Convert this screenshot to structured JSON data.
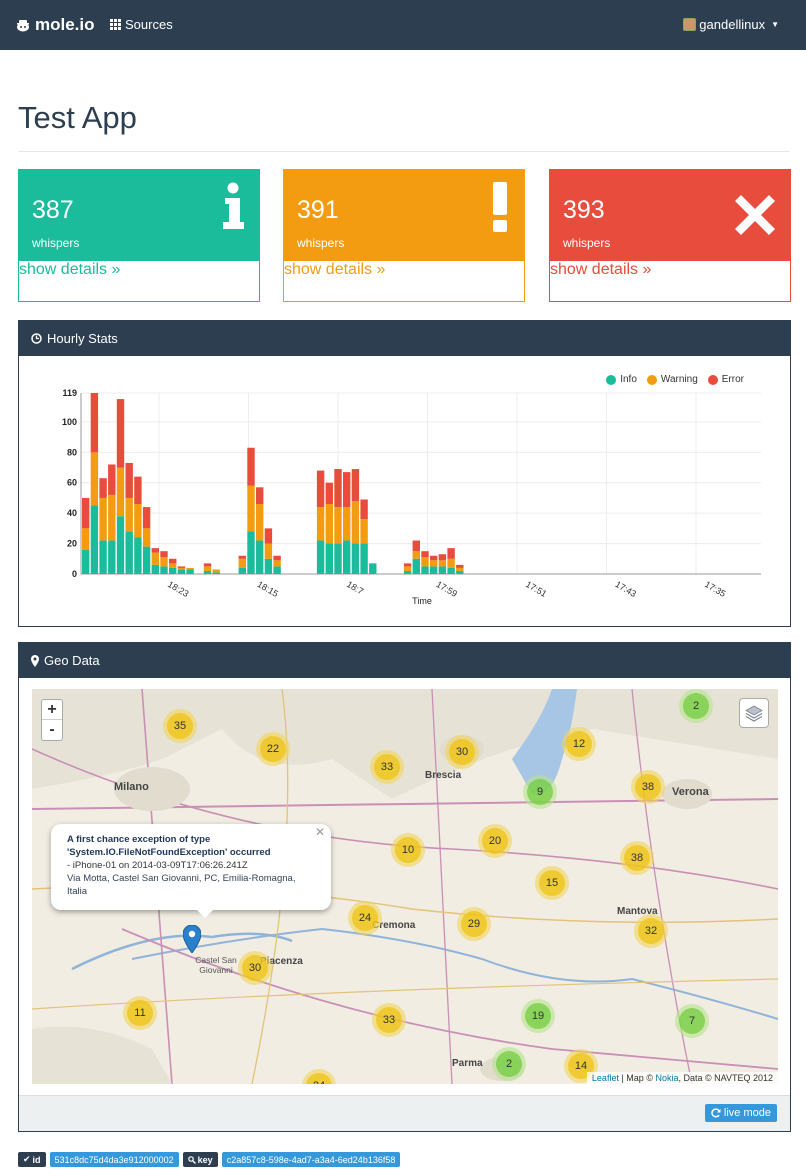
{
  "navbar": {
    "brand": "mole.io",
    "sources": "Sources",
    "user": "gandellinux"
  },
  "page": {
    "title": "Test App"
  },
  "cards": [
    {
      "value": "387",
      "label": "whispers",
      "link": "show details »",
      "color": "#1abc9c",
      "icon": "info-icon"
    },
    {
      "value": "391",
      "label": "whispers",
      "link": "show details »",
      "color": "#f39c12",
      "icon": "exclamation-icon"
    },
    {
      "value": "393",
      "label": "whispers",
      "link": "show details »",
      "color": "#e74c3c",
      "icon": "times-icon"
    }
  ],
  "hourly": {
    "title": "Hourly Stats",
    "chart_data": {
      "type": "bar",
      "stacked": true,
      "xlabel": "Time",
      "ylim": [
        0,
        119
      ],
      "yticks": [
        0,
        20,
        40,
        60,
        80,
        100,
        119
      ],
      "xticks": [
        "18:23",
        "18:15",
        "18:7",
        "17:59",
        "17:51",
        "17:43",
        "17:35"
      ],
      "legend_position": "top-right",
      "series": [
        {
          "name": "Info",
          "color": "#1abc9c",
          "values": [
            16,
            45,
            22,
            22,
            38,
            28,
            24,
            18,
            6,
            5,
            4,
            3,
            3,
            0,
            2,
            1,
            0,
            0,
            4,
            28,
            22,
            10,
            5,
            0,
            0,
            0,
            0,
            22,
            20,
            20,
            22,
            20,
            20,
            7,
            0,
            0,
            0,
            2,
            10,
            5,
            5,
            5,
            4,
            2
          ]
        },
        {
          "name": "Warning",
          "color": "#f39c12",
          "values": [
            14,
            35,
            28,
            30,
            32,
            22,
            22,
            12,
            8,
            6,
            3,
            1,
            1,
            0,
            3,
            2,
            0,
            0,
            6,
            30,
            24,
            10,
            4,
            0,
            0,
            0,
            0,
            22,
            26,
            24,
            22,
            28,
            16,
            0,
            0,
            0,
            0,
            3,
            5,
            6,
            4,
            4,
            6,
            2
          ]
        },
        {
          "name": "Error",
          "color": "#e74c3c",
          "values": [
            20,
            39,
            13,
            20,
            45,
            23,
            18,
            14,
            3,
            4,
            3,
            1,
            0,
            0,
            2,
            0,
            0,
            0,
            2,
            25,
            11,
            10,
            3,
            0,
            0,
            0,
            0,
            24,
            14,
            25,
            23,
            21,
            13,
            0,
            0,
            0,
            0,
            2,
            7,
            4,
            3,
            4,
            7,
            2
          ]
        }
      ]
    }
  },
  "geo": {
    "title": "Geo Data",
    "zoom_in": "+",
    "zoom_out": "-",
    "popup": {
      "title": "A first chance exception of type 'System.IO.FileNotFoundException' occurred",
      "line2": "- iPhone-01 on 2014-03-09T17:06:26.241Z",
      "line3": "Via Motta, Castel San Giovanni, PC, Emilia-Romagna, Italia"
    },
    "clusters": [
      {
        "n": "35",
        "c": "y"
      },
      {
        "n": "22",
        "c": "y"
      },
      {
        "n": "33",
        "c": "y"
      },
      {
        "n": "30",
        "c": "y"
      },
      {
        "n": "12",
        "c": "y"
      },
      {
        "n": "2",
        "c": "g"
      },
      {
        "n": "38",
        "c": "y"
      },
      {
        "n": "9",
        "c": "g"
      },
      {
        "n": "10",
        "c": "y"
      },
      {
        "n": "20",
        "c": "y"
      },
      {
        "n": "15",
        "c": "y"
      },
      {
        "n": "38",
        "c": "y"
      },
      {
        "n": "24",
        "c": "y"
      },
      {
        "n": "29",
        "c": "y"
      },
      {
        "n": "32",
        "c": "y"
      },
      {
        "n": "30",
        "c": "y"
      },
      {
        "n": "11",
        "c": "y"
      },
      {
        "n": "33",
        "c": "y"
      },
      {
        "n": "19",
        "c": "g"
      },
      {
        "n": "7",
        "c": "g"
      },
      {
        "n": "2",
        "c": "g"
      },
      {
        "n": "14",
        "c": "y"
      },
      {
        "n": "24",
        "c": "y"
      }
    ],
    "places": [
      "Milano",
      "Brescia",
      "Verona",
      "Cremona",
      "Piacenza",
      "Parma",
      "Mantova",
      "Castel San Giovanni"
    ],
    "attribution": {
      "leaflet": "Leaflet",
      "mid": "| Map ©",
      "nokia": "Nokia",
      "rest": ", Data © NAVTEQ 2012"
    },
    "live_mode": "live mode"
  },
  "tags": {
    "id_label": "id",
    "id_value": "531c8dc75d4da3e912000002",
    "key_label": "key",
    "key_value": "c2a857c8-598e-4ad7-a3a4-6ed24b136f58"
  }
}
